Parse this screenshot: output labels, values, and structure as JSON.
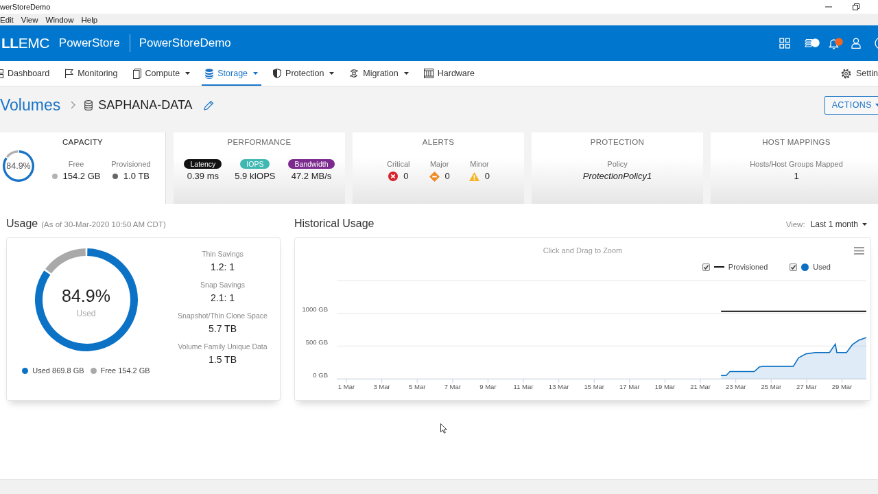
{
  "window": {
    "title": "werStoreDemo"
  },
  "menu_bar": [
    "Edit",
    "View",
    "Window",
    "Help"
  ],
  "header": {
    "logo": "**LL**EMC",
    "product": "PowerStore",
    "system": "PowerStoreDemo"
  },
  "nav": {
    "items": [
      {
        "label": "Dashboard",
        "has_menu": false,
        "selected": false
      },
      {
        "label": "Monitoring",
        "has_menu": false,
        "selected": false
      },
      {
        "label": "Compute",
        "has_menu": true,
        "selected": false
      },
      {
        "label": "Storage",
        "has_menu": true,
        "selected": true
      },
      {
        "label": "Protection",
        "has_menu": true,
        "selected": false
      },
      {
        "label": "Migration",
        "has_menu": true,
        "selected": false
      },
      {
        "label": "Hardware",
        "has_menu": false,
        "selected": false
      }
    ],
    "settings": "Settin"
  },
  "breadcrumb": {
    "parent": "Volumes",
    "current": "SAPHANA-DATA"
  },
  "actions_button": "ACTIONS",
  "summary_cards": [
    {
      "kind": "capacity",
      "title": "CAPACITY",
      "selected": true,
      "chart_data": {
        "type": "donut",
        "values": [
          84.9,
          15.1
        ],
        "colors": [
          "#1a73c7",
          "#b0b0b0"
        ],
        "annotations": [
          "84.9%"
        ]
      },
      "stats": [
        {
          "label": "Free",
          "value": "154.2 GB",
          "color": "#b3b3b3"
        },
        {
          "label": "Provisioned",
          "value": "1.0 TB",
          "color": "#666666"
        }
      ]
    },
    {
      "kind": "performance",
      "title": "PERFORMANCE",
      "selected": false,
      "metrics": [
        {
          "label": "Latency",
          "value": "0.39 ms",
          "color": "#111111"
        },
        {
          "label": "IOPS",
          "value": "5.9 kIOPS",
          "color": "#3fb8b2"
        },
        {
          "label": "Bandwidth",
          "value": "47.2 MB/s",
          "color": "#7b2a8e"
        }
      ]
    },
    {
      "kind": "alerts",
      "title": "ALERTS",
      "selected": false,
      "alerts": [
        {
          "kind": "critical",
          "label": "Critical",
          "count": "0"
        },
        {
          "kind": "major",
          "label": "Major",
          "count": "0"
        },
        {
          "kind": "minor",
          "label": "Minor",
          "count": "0"
        }
      ]
    },
    {
      "kind": "protection",
      "title": "PROTECTION",
      "selected": false,
      "label": "Policy",
      "value": "ProtectionPolicy1"
    },
    {
      "kind": "host_mappings",
      "title": "HOST MAPPINGS",
      "selected": false,
      "label": "Hosts/Host Groups Mapped",
      "value": "1"
    }
  ],
  "usage": {
    "title": "Usage",
    "as_of": "(As of 30-Mar-2020 10:50 AM CDT)",
    "chart_data": {
      "type": "donut",
      "categories": [
        "Used 869.8 GB",
        "Free 154.2 GB"
      ],
      "values": [
        869.8,
        154.2
      ],
      "colors": [
        "#0b72c5",
        "#a9a9a9"
      ],
      "legend": "bottom",
      "annotations": [
        "84.9%",
        "Used"
      ]
    },
    "stats": [
      {
        "label": "Thin Savings",
        "value": "1.2: 1"
      },
      {
        "label": "Snap Savings",
        "value": "2.1: 1"
      },
      {
        "label": "Snapshot/Thin Clone Space",
        "value": "5.7 TB"
      },
      {
        "label": "Volume Family Unique Data",
        "value": "1.5 TB"
      }
    ]
  },
  "historical": {
    "title": "Historical Usage",
    "view_label": "View:",
    "view_value": "Last 1 month",
    "legend_checkboxes": [
      {
        "checked": true
      },
      {
        "checked": true
      }
    ],
    "chart_data": {
      "type": "area",
      "subtitle": "Click and Drag to Zoom",
      "legend": "top-right",
      "grid": true,
      "xlim": [
        "2020-02-29T11:00",
        "2020-03-30T09:00"
      ],
      "ylim": [
        0,
        1500
      ],
      "xticks": [
        {
          "value": "2020-03-01",
          "label": "1 Mar"
        },
        {
          "value": "2020-03-03",
          "label": "3 Mar"
        },
        {
          "value": "2020-03-05",
          "label": "5 Mar"
        },
        {
          "value": "2020-03-07",
          "label": "7 Mar"
        },
        {
          "value": "2020-03-09",
          "label": "9 Mar"
        },
        {
          "value": "2020-03-11",
          "label": "11 Mar"
        },
        {
          "value": "2020-03-13",
          "label": "13 Mar"
        },
        {
          "value": "2020-03-15",
          "label": "15 Mar"
        },
        {
          "value": "2020-03-17",
          "label": "17 Mar"
        },
        {
          "value": "2020-03-19",
          "label": "19 Mar"
        },
        {
          "value": "2020-03-21",
          "label": "21 Mar"
        },
        {
          "value": "2020-03-23",
          "label": "23 Mar"
        },
        {
          "value": "2020-03-25",
          "label": "25 Mar"
        },
        {
          "value": "2020-03-27",
          "label": "27 Mar"
        },
        {
          "value": "2020-03-29",
          "label": "29 Mar"
        }
      ],
      "yticks": [
        {
          "value": 0,
          "label": "0 GB"
        },
        {
          "value": 500,
          "label": "500 GB"
        },
        {
          "value": 1000,
          "label": "1000 GB"
        }
      ],
      "series": [
        {
          "name": "Provisioned",
          "type": "line",
          "color": "#111111",
          "x": [
            "2020-03-22T04:00",
            "2020-03-30T09:00"
          ],
          "values": [
            1030,
            1030
          ]
        },
        {
          "name": "Used",
          "type": "area",
          "color": "#0b6fc2",
          "x": [
            "2020-03-22T04:00",
            "2020-03-22T11:00",
            "2020-03-22T16:00",
            "2020-03-24T01:00",
            "2020-03-24T08:00",
            "2020-03-24T14:00",
            "2020-03-26T06:00",
            "2020-03-26T13:00",
            "2020-03-26T23:00",
            "2020-03-27T12:00",
            "2020-03-28T07:00",
            "2020-03-28T15:00",
            "2020-03-28T17:00",
            "2020-03-29T06:00",
            "2020-03-29T14:00",
            "2020-03-29T23:00",
            "2020-03-30T09:00"
          ],
          "values": [
            50,
            50,
            110,
            110,
            180,
            190,
            190,
            320,
            380,
            400,
            400,
            530,
            400,
            400,
            520,
            590,
            630
          ]
        }
      ]
    }
  }
}
